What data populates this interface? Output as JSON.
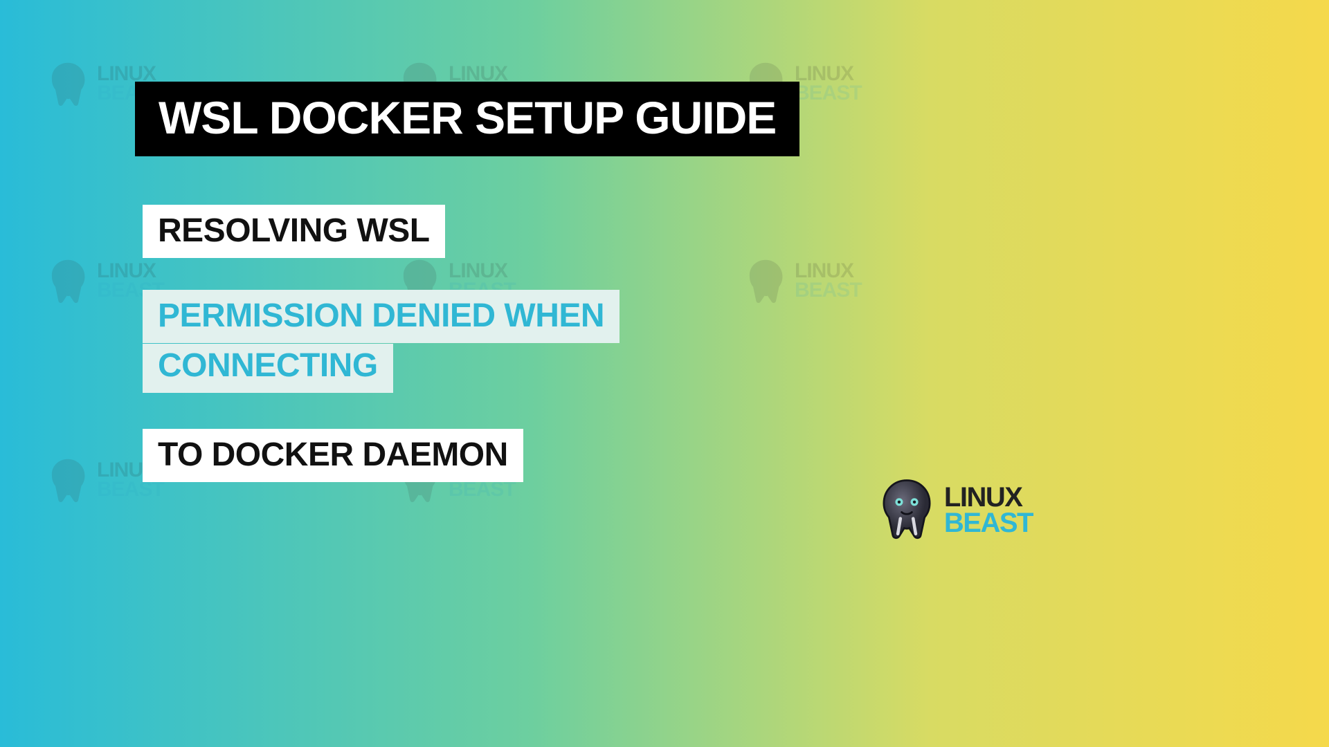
{
  "banner": {
    "title": "WSL DOCKER SETUP GUIDE"
  },
  "subtitle": {
    "line1": "RESOLVING WSL",
    "line2": "PERMISSION DENIED WHEN",
    "line3": "CONNECTING",
    "line4": "TO DOCKER DAEMON"
  },
  "brand": {
    "word1": "LINUX",
    "word2": "BEAST"
  },
  "colors": {
    "black": "#000000",
    "white": "#ffffff",
    "lightBg": "#e2f1ee",
    "cyanText": "#30b7d4"
  }
}
